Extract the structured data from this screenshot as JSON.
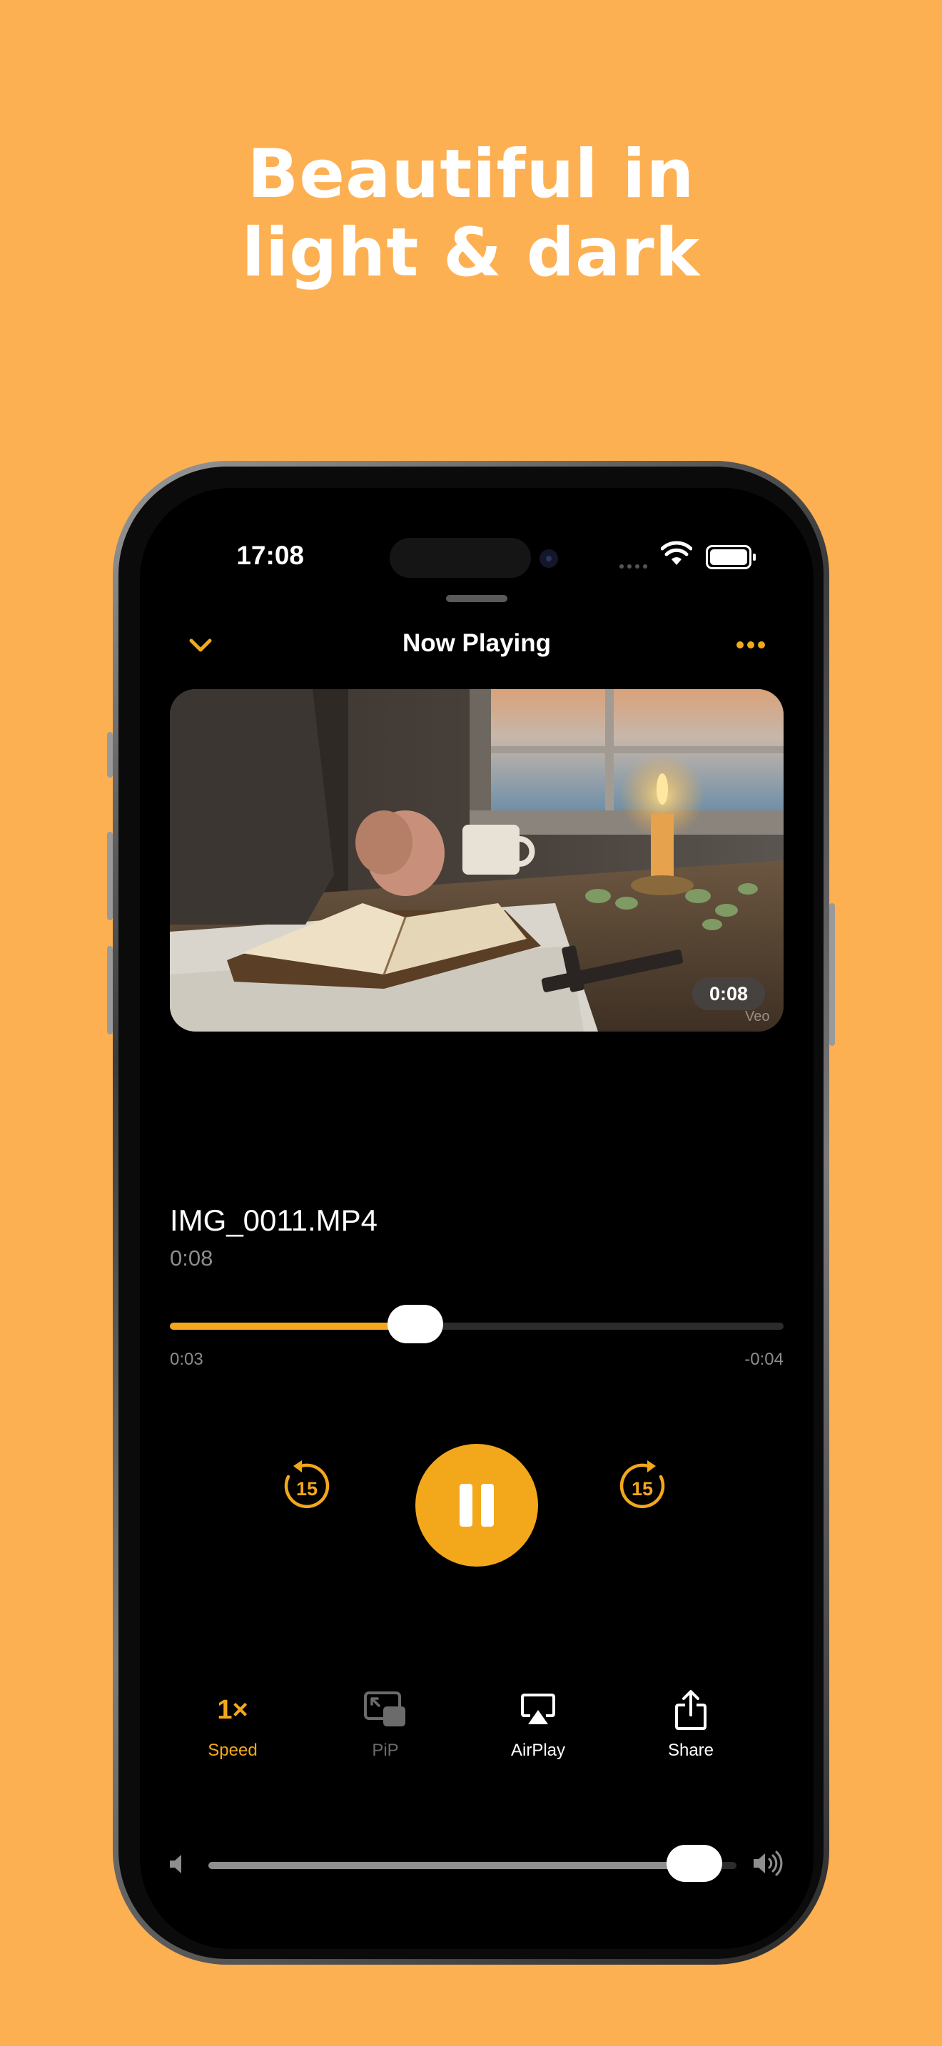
{
  "headline": {
    "line1": "Beautiful in",
    "line2": "light & dark"
  },
  "status_bar": {
    "time": "17:08"
  },
  "header": {
    "title": "Now Playing",
    "collapse_icon": "chevron-down-icon",
    "more_icon": "ellipsis-icon"
  },
  "video": {
    "duration_badge": "0:08",
    "watermark": "Veo"
  },
  "track": {
    "file_name": "IMG_0011.MP4",
    "duration": "0:08"
  },
  "scrubber": {
    "elapsed": "0:03",
    "remaining": "-0:04",
    "progress": 0.4
  },
  "controls": {
    "skip_back_label": "15",
    "skip_forward_label": "15",
    "state": "playing"
  },
  "toolbar": {
    "speed": {
      "value": "1×",
      "label": "Speed"
    },
    "pip": {
      "label": "PiP"
    },
    "airplay": {
      "label": "AirPlay"
    },
    "share": {
      "label": "Share"
    }
  },
  "volume": {
    "level": 0.92
  },
  "colors": {
    "background": "#FDB052",
    "accent": "#F3A81C",
    "screen": "#000000",
    "disabled": "#6b6b6b"
  }
}
